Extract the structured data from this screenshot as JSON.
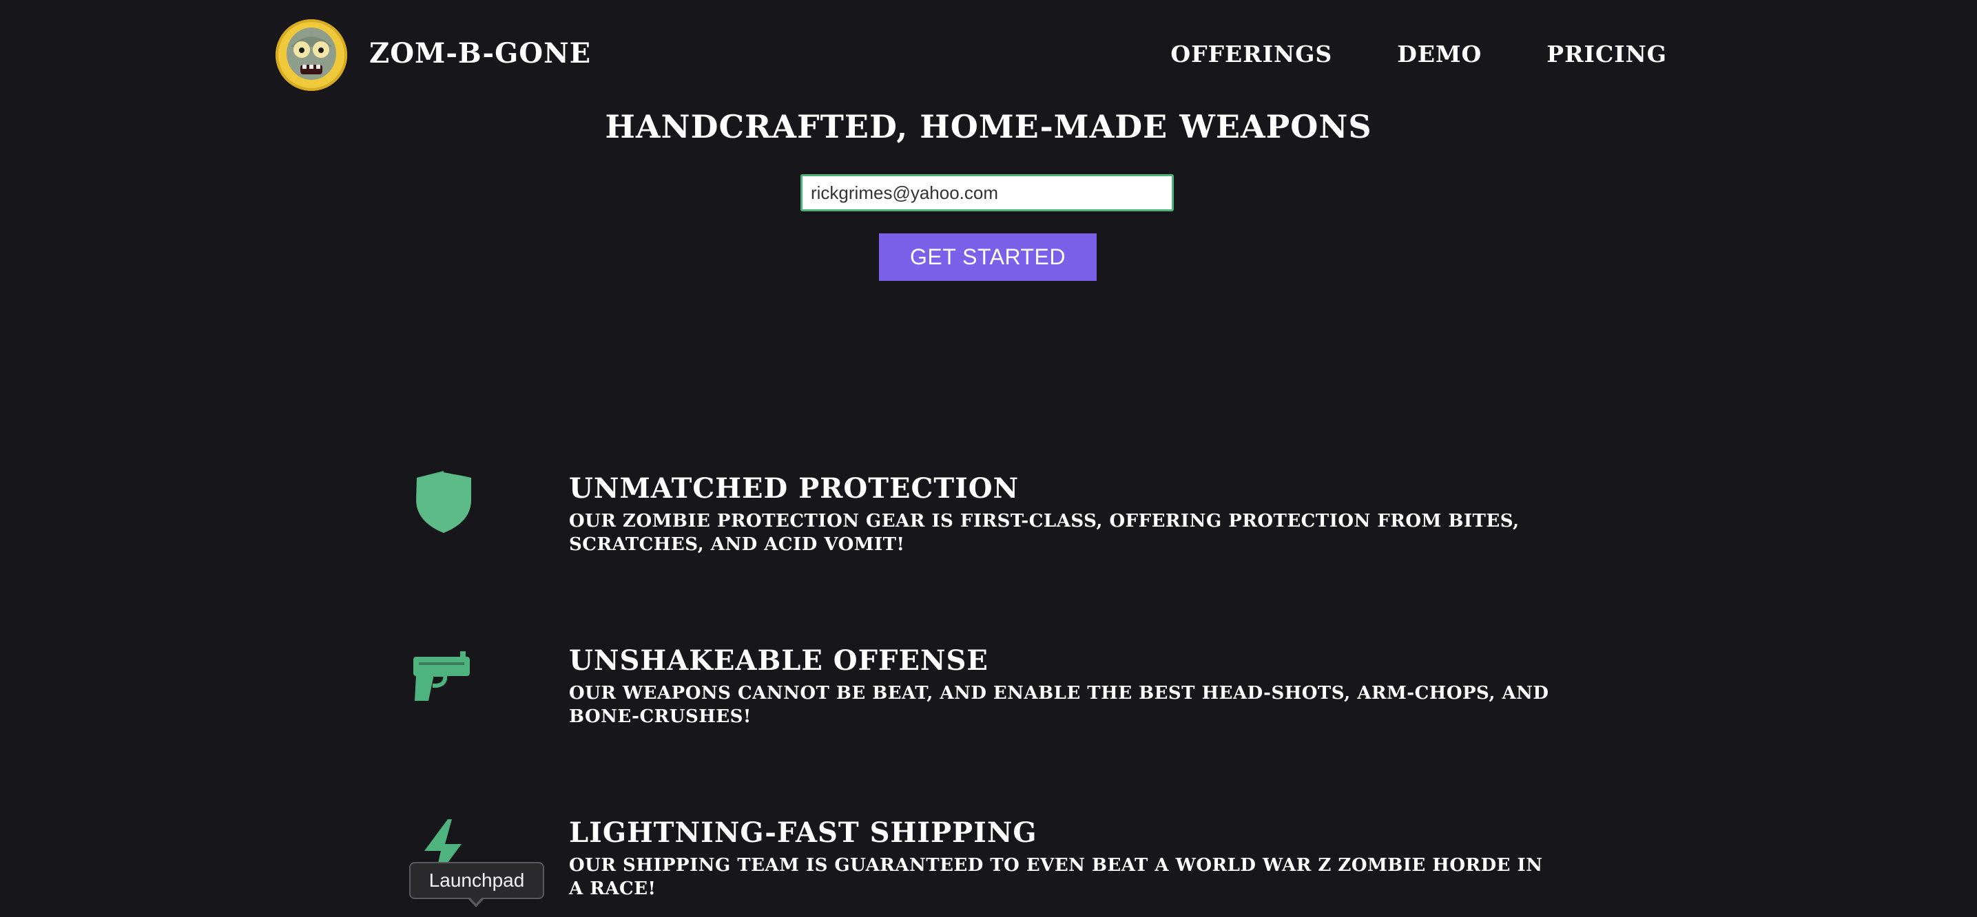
{
  "header": {
    "brand": "ZOM-B-GONE",
    "logo_icon": "zombie-head-icon",
    "nav": [
      {
        "label": "OFFERINGS"
      },
      {
        "label": "DEMO"
      },
      {
        "label": "PRICING"
      }
    ]
  },
  "hero": {
    "title": "HANDCRAFTED, HOME-MADE WEAPONS",
    "email_value": "rickgrimes@yahoo.com",
    "email_placeholder": "rickgrimes@yahoo.com",
    "cta_label": "GET STARTED"
  },
  "features": [
    {
      "icon": "shield-icon",
      "title": "UNMATCHED PROTECTION",
      "description": "OUR ZOMBIE PROTECTION GEAR IS FIRST-CLASS, OFFERING PROTECTION FROM BITES, SCRATCHES, AND ACID VOMIT!"
    },
    {
      "icon": "gun-icon",
      "title": "UNSHAKEABLE OFFENSE",
      "description": "OUR WEAPONS CANNOT BE BEAT, AND ENABLE THE BEST HEAD-SHOTS, ARM-CHOPS, AND BONE-CRUSHES!"
    },
    {
      "icon": "lightning-bolt-icon",
      "title": "LIGHTNING-FAST SHIPPING",
      "description": "OUR SHIPPING TEAM IS GUARANTEED TO EVEN BEAT A WORLD WAR Z ZOMBIE HORDE IN A RACE!"
    }
  ],
  "tooltip": {
    "label": "Launchpad"
  },
  "colors": {
    "background": "#17171b",
    "accent_green": "#4fb37f",
    "button_purple": "#7b60ea",
    "logo_yellow": "#f0c93a"
  }
}
